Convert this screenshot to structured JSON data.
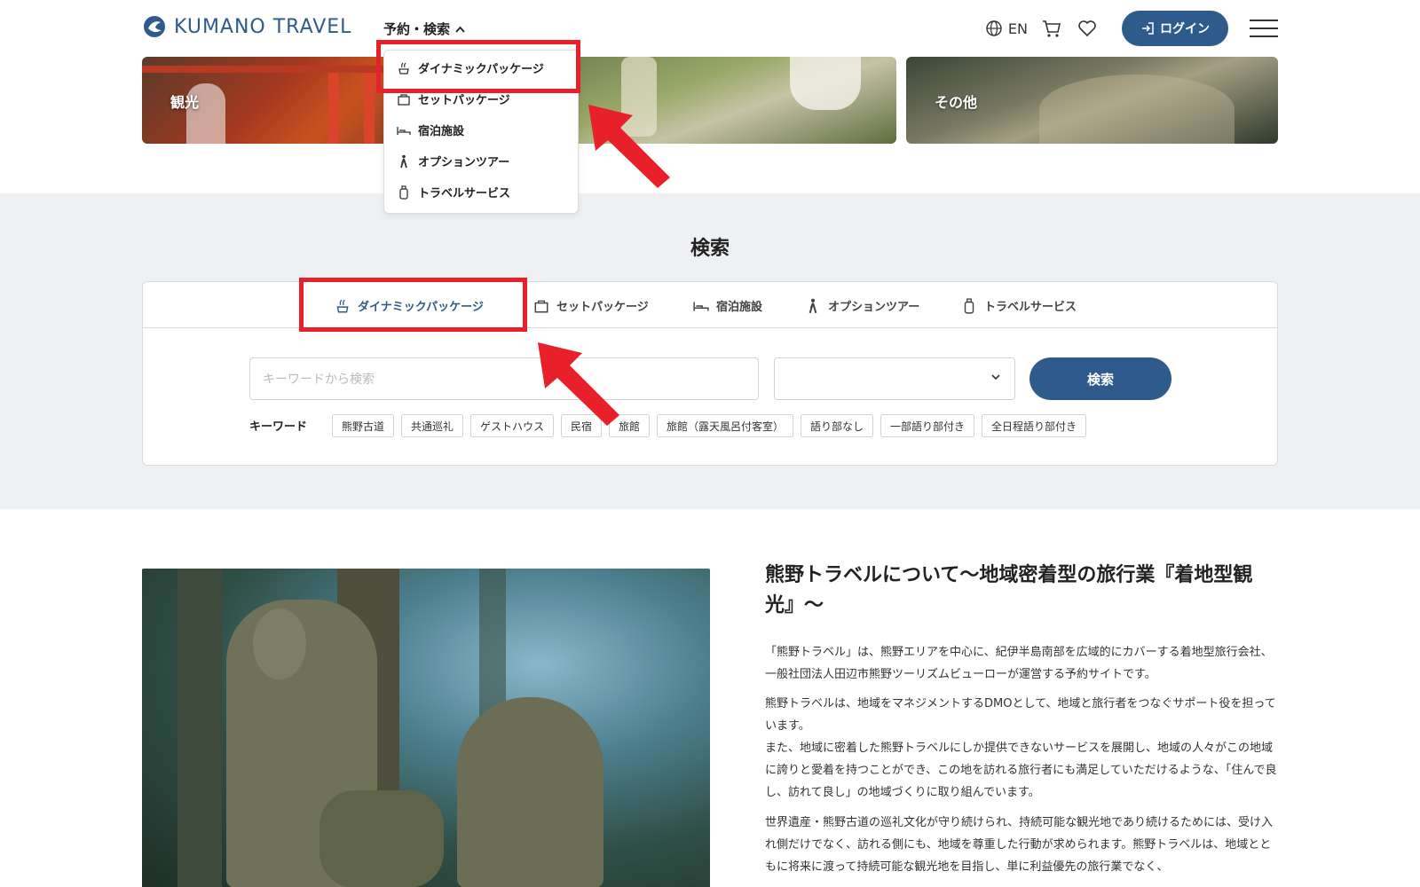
{
  "header": {
    "logo_text": "KUMANO TRAVEL",
    "nav_label": "予約・検索",
    "lang_label": "EN",
    "login_label": "ログイン"
  },
  "categories": [
    {
      "label": "観光"
    },
    {
      "label": ""
    },
    {
      "label": "その他"
    }
  ],
  "dropdown": {
    "items": [
      {
        "label": "ダイナミックパッケージ",
        "icon": "dynamic-package-icon"
      },
      {
        "label": "セットパッケージ",
        "icon": "set-package-icon"
      },
      {
        "label": "宿泊施設",
        "icon": "bed-icon"
      },
      {
        "label": "オプションツアー",
        "icon": "hiker-icon"
      },
      {
        "label": "トラベルサービス",
        "icon": "bottle-icon"
      }
    ]
  },
  "search": {
    "title": "検索",
    "tabs": [
      {
        "label": "ダイナミックパッケージ",
        "active": true
      },
      {
        "label": "セットパッケージ",
        "active": false
      },
      {
        "label": "宿泊施設",
        "active": false
      },
      {
        "label": "オプションツアー",
        "active": false
      },
      {
        "label": "トラベルサービス",
        "active": false
      }
    ],
    "keyword_placeholder": "キーワードから検索",
    "select_value": "",
    "search_button": "検索",
    "keyword_label": "キーワード",
    "tags": [
      "熊野古道",
      "共通巡礼",
      "ゲストハウス",
      "民宿",
      "旅館",
      "旅館（露天風呂付客室）",
      "語り部なし",
      "一部語り部付き",
      "全日程語り部付き"
    ]
  },
  "about": {
    "title": "熊野トラベルについて〜地域密着型の旅行業『着地型観光』〜",
    "p1": "「熊野トラベル」は、熊野エリアを中心に、紀伊半島南部を広域的にカバーする着地型旅行会社、一般社団法人田辺市熊野ツーリズムビューローが運営する予約サイトです。",
    "p2": "熊野トラベルは、地域をマネジメントするDMOとして、地域と旅行者をつなぐサポート役を担っています。",
    "p3": "また、地域に密着した熊野トラベルにしか提供できないサービスを展開し、地域の人々がこの地域に誇りと愛着を持つことができ、この地を訪れる旅行者にも満足していただけるような、「住んで良し、訪れて良し」の地域づくりに取り組んでいます。",
    "p4": "世界遺産・熊野古道の巡礼文化が守り続けられ、持続可能な観光地であり続けるためには、受け入れ側だけでなく、訪れる側にも、地域を尊重した行動が求められます。熊野トラベルは、地域とともに将来に渡って持続可能な観光地を目指し、単に利益優先の旅行業でなく、"
  },
  "colors": {
    "brand": "#2e5b8c",
    "annotation": "#e8202a",
    "section_bg": "#eef0f3"
  }
}
